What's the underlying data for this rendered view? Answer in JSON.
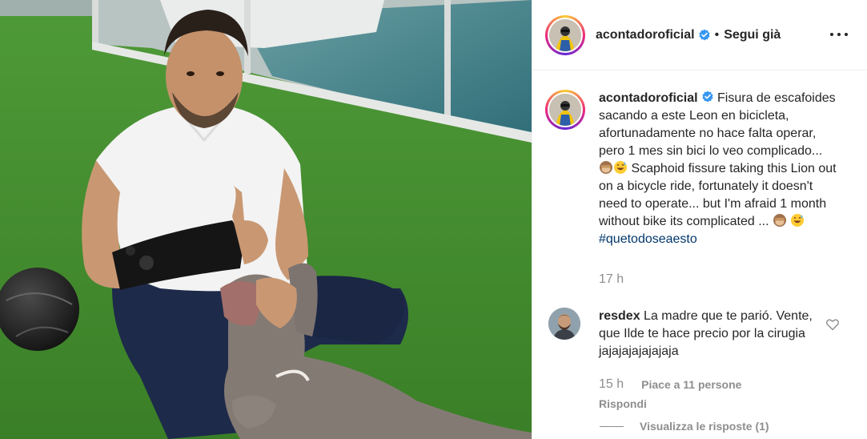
{
  "photo": {
    "alt_icon": "post-photo"
  },
  "header": {
    "username": "acontadoroficial",
    "separator": "•",
    "follow_label": "Segui già",
    "more_icon": "more-options-icon",
    "verified_icon": "verified-badge-icon"
  },
  "caption": {
    "username": "acontadoroficial",
    "text_part1": " Fisura de escafoides sacando a este Leon en bicicleta, afortunadamente no hace falta operar, pero 1 mes sin bici lo veo complicado... ",
    "text_part2": " Scaphoid fissure taking this Lion out on a bicycle ride, fortunately it doesn't need to operate... but I'm afraid 1 month without bike its complicated ... ",
    "hashtag": "#quetodoseaesto",
    "time": "17 h"
  },
  "comment": {
    "username": "resdex",
    "text": " La madre que te parió. Vente, que Ilde te hace precio por la cirugia jajajajajajajaja",
    "time": "15 h",
    "likes": "Piace a 11 persone",
    "reply_label": "Rispondi",
    "view_replies_label": "Visualizza le risposte (1)"
  },
  "colors": {
    "verified": "#3897f0",
    "text": "#262626",
    "muted": "#8e8e8e",
    "hashtag": "#00376b"
  }
}
